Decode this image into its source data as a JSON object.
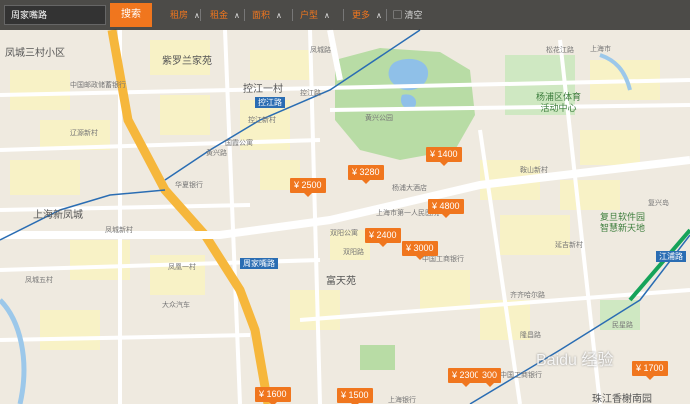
{
  "search": {
    "value": "周家嘴路",
    "button": "搜索"
  },
  "filters": {
    "items": [
      "租房",
      "租金",
      "面积",
      "户型",
      "更多"
    ],
    "clear": "清空"
  },
  "pins": [
    "¥ 1400",
    "¥ 3280",
    "¥ 2500",
    "¥ 4800",
    "¥ 2400",
    "¥ 3000",
    "¥ 2300",
    "300",
    "¥ 1700",
    "¥ 1600",
    "¥ 1500"
  ],
  "areas": {
    "a1": "凤城三村小区",
    "a2": "紫罗兰家苑",
    "a3": "控江一村",
    "a4": "上海新凤城",
    "a5": "富天苑",
    "a6": "杨浦区体育\n活动中心",
    "a7": "复旦软件园\n智慧新天地",
    "a8": "珠江香榭南园"
  },
  "stations": {
    "s1": "控江路",
    "s2": "周家嘴路",
    "s3": "江浦路"
  },
  "places": [
    "中国邮政储蓄银行",
    "黄兴路",
    "黄兴公园",
    "华夏银行",
    "中国工商银行",
    "杨浦大酒店",
    "复兴岛",
    "国霞公寓",
    "上海市第一人民医院",
    "凤城新村",
    "凤凰一村",
    "双阳公寓",
    "双阳路",
    "大众汽车",
    "控江路",
    "凤城五村",
    "凤城路",
    "控江新村",
    "上海银行",
    "中国工商银行",
    "鞍山新村",
    "隆昌路",
    "延吉新村",
    "齐齐哈尔路",
    "松花江路",
    "民星路",
    "上海市",
    "辽源新村"
  ],
  "watermark": "Baidu 经验"
}
